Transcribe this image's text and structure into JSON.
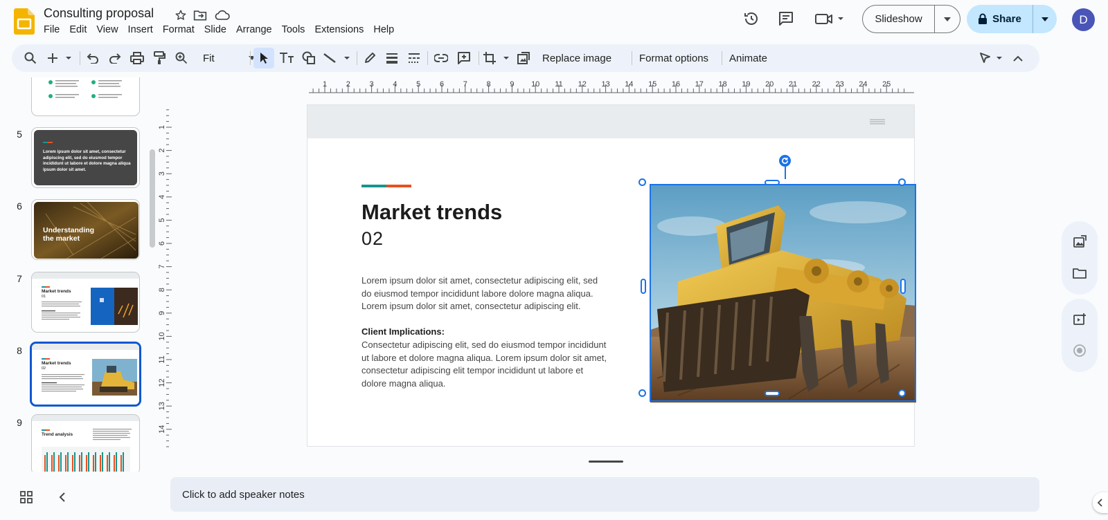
{
  "header": {
    "doc_title": "Consulting proposal",
    "menus": [
      "File",
      "Edit",
      "View",
      "Insert",
      "Format",
      "Slide",
      "Arrange",
      "Tools",
      "Extensions",
      "Help"
    ],
    "slideshow_label": "Slideshow",
    "share_label": "Share",
    "avatar_initial": "D"
  },
  "toolbar": {
    "zoom_value": "Fit",
    "replace_image_label": "Replace image",
    "format_options_label": "Format options",
    "animate_label": "Animate"
  },
  "filmstrip": {
    "slides": [
      {
        "number": "5",
        "text": "Lorem ipsum dolor sit amet, consectetur adipiscing elit, sed do eiusmod tempor incididunt ut labore et dolore magna aliqua ipsum dolor sit amet."
      },
      {
        "number": "6",
        "title": "Understanding the market"
      },
      {
        "number": "7",
        "title": "Market trends",
        "subtitle": "01"
      },
      {
        "number": "8",
        "title": "Market trends",
        "subtitle": "02"
      },
      {
        "number": "9",
        "title": "Trend analysis"
      }
    ],
    "selected": "8"
  },
  "ruler": {
    "h_labels": [
      "1",
      "2",
      "3",
      "4",
      "5",
      "6",
      "7",
      "8",
      "9",
      "10",
      "11",
      "12",
      "13",
      "14",
      "15",
      "16",
      "17",
      "18",
      "19",
      "20",
      "21",
      "22",
      "23",
      "24",
      "25"
    ],
    "v_labels": [
      "1",
      "2",
      "3",
      "4",
      "5",
      "6",
      "7",
      "8",
      "9",
      "10",
      "11",
      "12",
      "13",
      "14"
    ]
  },
  "slide": {
    "title": "Market trends",
    "number": "02",
    "body": "Lorem ipsum dolor sit amet, consectetur adipiscing elit, sed do eiusmod tempor incididunt labore dolore magna aliqua. Lorem ipsum dolor sit amet, consectetur adipiscing elit.",
    "implications_title": "Client Implications:",
    "implications_body": "Consectetur adipiscing elit, sed do eiusmod tempor incididunt ut labore et dolore magna aliqua. Lorem ipsum dolor sit amet, consectetur adipiscing elit tempor incididunt ut labore et dolore magna aliqua."
  },
  "notes": {
    "placeholder": "Click to add speaker notes"
  },
  "colors": {
    "accent_blue": "#1a73e8",
    "share_bg": "#c2e7ff",
    "teal": "#15958f",
    "orange": "#e8511d"
  }
}
